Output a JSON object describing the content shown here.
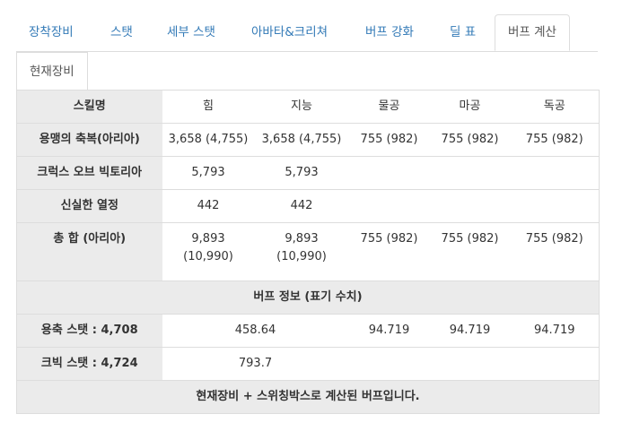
{
  "tabs": [
    {
      "label": "장착장비",
      "active": false
    },
    {
      "label": "스탯",
      "active": false
    },
    {
      "label": "세부 스탯",
      "active": false
    },
    {
      "label": "아바타&크리쳐",
      "active": false
    },
    {
      "label": "버프 강화",
      "active": false
    },
    {
      "label": "딜 표",
      "active": false
    },
    {
      "label": "버프 계산",
      "active": true
    }
  ],
  "subtab": "현재장비",
  "table": {
    "headers": [
      "스킬명",
      "힘",
      "지능",
      "물공",
      "마공",
      "독공"
    ],
    "rows": [
      {
        "name": "용맹의 축복(아리아)",
        "cells": [
          "3,658 (4,755)",
          "3,658 (4,755)",
          "755 (982)",
          "755 (982)",
          "755 (982)"
        ]
      },
      {
        "name": "크럭스 오브 빅토리아",
        "cells": [
          "5,793",
          "5,793",
          "",
          "",
          ""
        ]
      },
      {
        "name": "신실한 열정",
        "cells": [
          "442",
          "442",
          "",
          "",
          ""
        ]
      },
      {
        "name": "총 합 (아리아)",
        "cells": [
          "9,893 (10,990)",
          "9,893 (10,990)",
          "755 (982)",
          "755 (982)",
          "755 (982)"
        ]
      }
    ],
    "info_header": "버프 정보 (표기 수치)",
    "info_rows": [
      {
        "label_prefix": "용축 스탯 : ",
        "label_value": "4,708",
        "stat": "458.64",
        "phys": "94.719",
        "mag": "94.719",
        "ind": "94.719"
      },
      {
        "label_prefix": "크빅 스탯 : ",
        "label_value": "4,724",
        "stat": "793.7",
        "phys": "",
        "mag": "",
        "ind": ""
      }
    ],
    "footer": "현재장비 + 스위칭박스로 계산된 버프입니다."
  }
}
